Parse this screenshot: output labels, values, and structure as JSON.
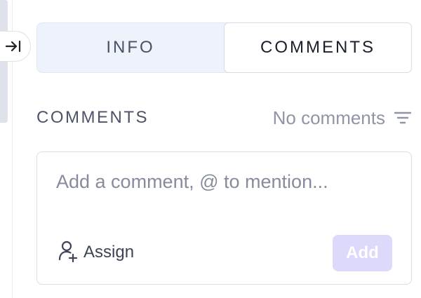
{
  "tabs": [
    {
      "label": "INFO",
      "active": false
    },
    {
      "label": "COMMENTS",
      "active": true
    }
  ],
  "comments_section": {
    "title": "COMMENTS",
    "status": "No comments",
    "filter_icon": "filter-icon"
  },
  "comment_box": {
    "placeholder": "Add a comment, @ to mention...",
    "value": "",
    "assign_label": "Assign",
    "assign_icon": "user-plus-icon",
    "add_label": "Add"
  },
  "sidebar": {
    "collapse_icon": "collapse-right-icon"
  },
  "colors": {
    "tab_bar_bg": "#eef2fb",
    "add_button_bg": "#dcd9fb"
  }
}
